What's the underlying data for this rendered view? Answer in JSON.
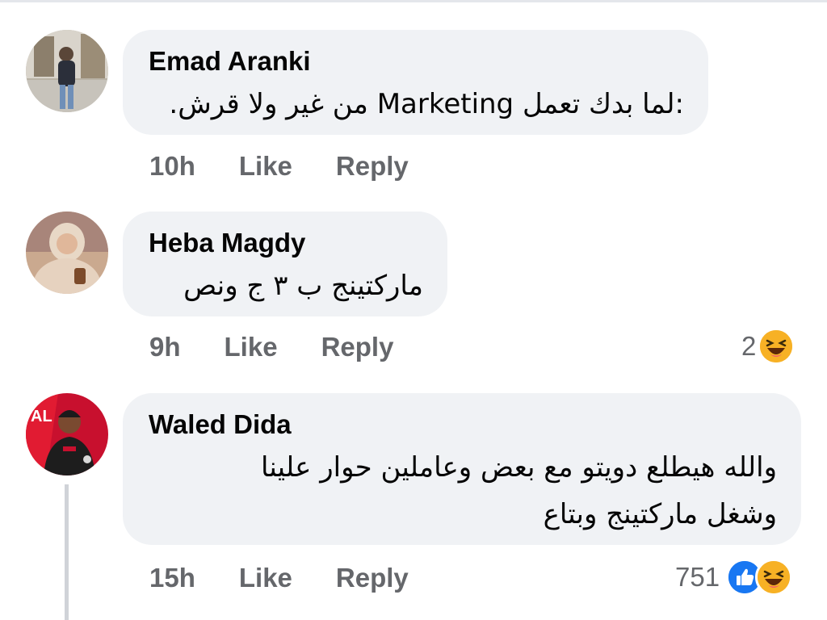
{
  "comments": [
    {
      "author": "Emad Aranki",
      "text": ":لما بدك تعمل Marketing من غير ولا قرش.",
      "time": "10h",
      "like_label": "Like",
      "reply_label": "Reply",
      "reaction_count": "",
      "reactions": []
    },
    {
      "author": "Heba Magdy",
      "text": "ماركتينج ب ٣ ج ونص",
      "time": "9h",
      "like_label": "Like",
      "reply_label": "Reply",
      "reaction_count": "2",
      "reactions": [
        "haha-icon"
      ]
    },
    {
      "author": "Waled Dida",
      "text_lines": [
        "والله هيطلع دويتو مع بعض وعاملين حوار علينا",
        "وشغل ماركتينج وبتاع"
      ],
      "time": "15h",
      "like_label": "Like",
      "reply_label": "Reply",
      "reaction_count": "751",
      "reactions": [
        "like-icon",
        "haha-icon"
      ],
      "avatar_badge_text": "AL"
    }
  ],
  "colors": {
    "bubble_bg": "#f0f2f5",
    "meta_text": "#65676b",
    "like_blue": "#1877f2",
    "haha_yellow": "#f7b125",
    "avatar_red": "#c8102e"
  }
}
